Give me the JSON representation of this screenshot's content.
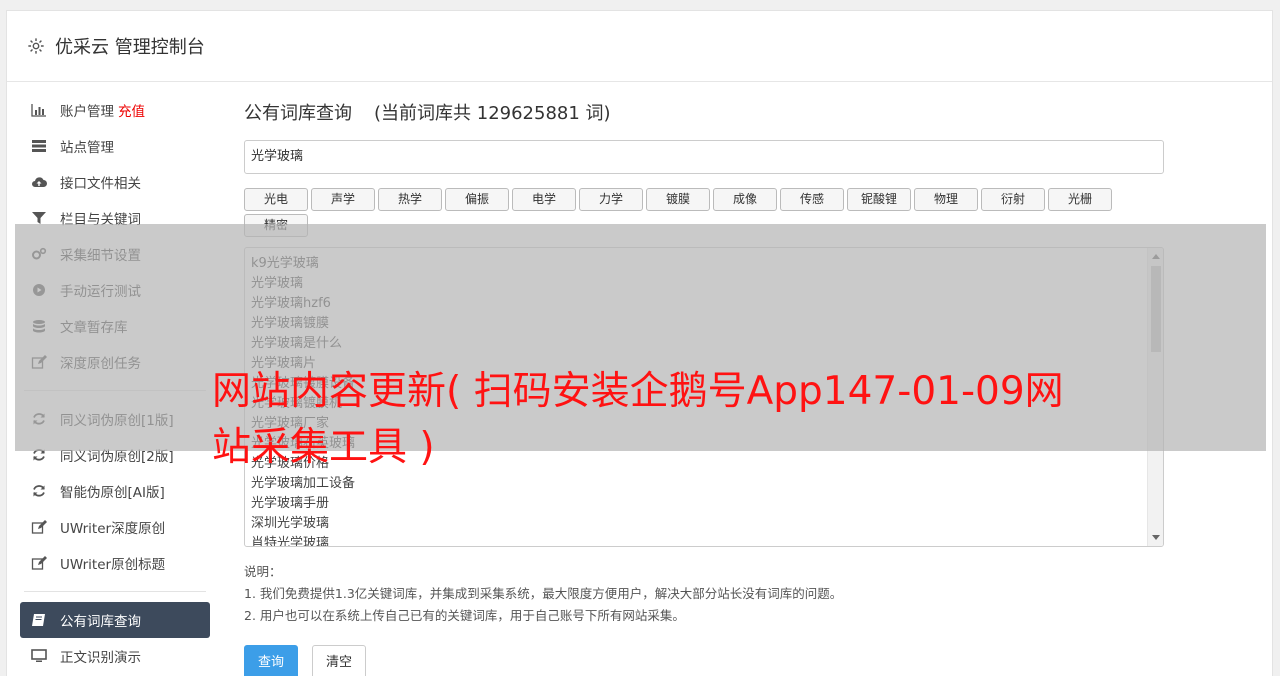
{
  "header": {
    "title": "优采云 管理控制台",
    "icon": "gear-icon"
  },
  "sidebar": {
    "group1": [
      {
        "label": "账户管理",
        "extra": "充值",
        "icon": "bar-chart-icon"
      },
      {
        "label": "站点管理",
        "icon": "server-icon"
      },
      {
        "label": "接口文件相关",
        "icon": "cloud-upload-icon"
      },
      {
        "label": "栏目与关键词",
        "icon": "filter-icon"
      },
      {
        "label": "采集细节设置",
        "icon": "gears-icon"
      },
      {
        "label": "手动运行测试",
        "icon": "play-circle-icon"
      },
      {
        "label": "文章暂存库",
        "icon": "database-icon"
      },
      {
        "label": "深度原创任务",
        "icon": "edit-icon"
      }
    ],
    "group2": [
      {
        "label": "同义词伪原创[1版]",
        "icon": "refresh-icon"
      },
      {
        "label": "同义词伪原创[2版]",
        "icon": "refresh-icon"
      },
      {
        "label": "智能伪原创[AI版]",
        "icon": "refresh-icon"
      },
      {
        "label": "UWriter深度原创",
        "icon": "edit-icon"
      },
      {
        "label": "UWriter原创标题",
        "icon": "edit-icon"
      }
    ],
    "group3": [
      {
        "label": "公有词库查询",
        "icon": "book-icon",
        "active": true
      },
      {
        "label": "正文识别演示",
        "icon": "monitor-icon"
      }
    ]
  },
  "main": {
    "title": "公有词库查询",
    "count_text": "(当前词库共 129625881 词)",
    "search_value": "光学玻璃",
    "tags": [
      "光电",
      "声学",
      "热学",
      "偏振",
      "电学",
      "力学",
      "镀膜",
      "成像",
      "传感",
      "铌酸锂",
      "物理",
      "衍射",
      "光栅",
      "精密"
    ],
    "results": [
      "k9光学玻璃",
      "光学玻璃",
      "光学玻璃hzf6",
      "光学玻璃镀膜",
      "光学玻璃是什么",
      "光学玻璃片",
      "光学玻璃镀膜设备",
      "光学玻璃镀膜机",
      "光学玻璃厂家",
      "光学玻璃石英玻璃",
      "光学玻璃价格",
      "光学玻璃加工设备",
      "光学玻璃手册",
      "深圳光学玻璃",
      "肖特光学玻璃"
    ],
    "notes_title": "说明：",
    "notes": [
      "1. 我们免费提供1.3亿关键词库，并集成到采集系统，最大限度方便用户，解决大部分站长没有词库的问题。",
      "2. 用户也可以在系统上传自己已有的关键词库，用于自己账号下所有网站采集。"
    ],
    "query_button": "查询",
    "clear_button": "清空"
  },
  "overlay": {
    "text": "网站内容更新( 扫码安装企鹅号App147-01-09网站采集工具 )"
  }
}
